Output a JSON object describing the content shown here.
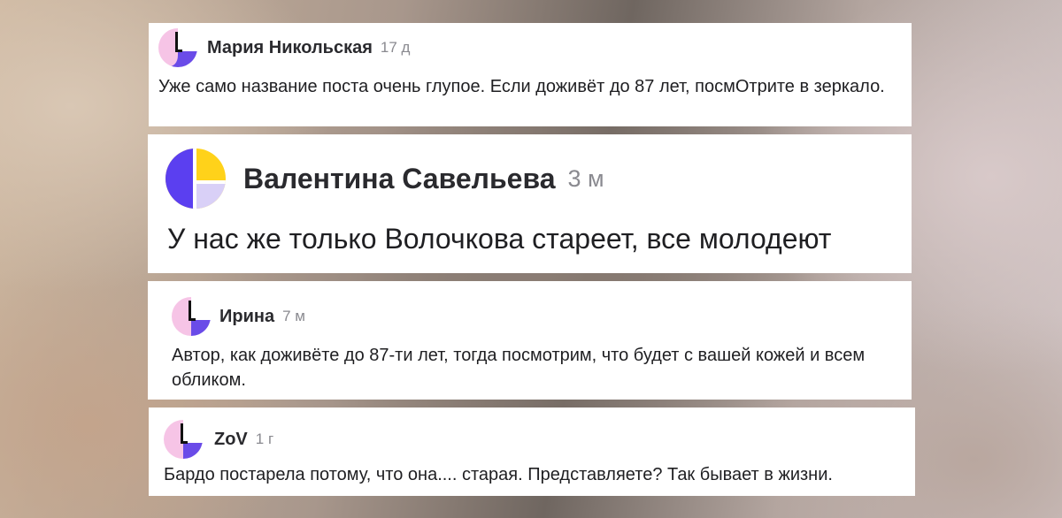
{
  "comments": [
    {
      "author": "Мария Никольская",
      "time": "17 д",
      "text": "Уже само название поста очень глупое. Если доживёт до 87 лет, посмОтрите в зеркало.",
      "avatar_colors": {
        "left": "#f6c4e6",
        "right": "#ffffff",
        "bottom": "#6a4be8",
        "mark": "#111111"
      }
    },
    {
      "author": "Валентина Савельева",
      "time": "3 м",
      "text": "У нас же только Волочкова стареет, все молодеют",
      "avatar_colors": {
        "left": "#5b3ff0",
        "right": "#ffd21a",
        "bottom": "#d9d0f7",
        "mark": "#ffffff"
      }
    },
    {
      "author": "Ирина",
      "time": "7 м",
      "text": "Автор, как доживёте до 87-ти лет, тогда посмотрим, что будет с вашей кожей и всем обликом.",
      "avatar_colors": {
        "left": "#f6c4e6",
        "right": "#ffffff",
        "bottom": "#6a4be8",
        "mark": "#111111"
      }
    },
    {
      "author": "ZoV",
      "time": "1 г",
      "text": "Бардо постарела потому, что она.... старая. Представляете? Так бывает в жизни.",
      "avatar_colors": {
        "left": "#f6c4e6",
        "right": "#ffffff",
        "bottom": "#6a4be8",
        "mark": "#111111"
      }
    }
  ]
}
